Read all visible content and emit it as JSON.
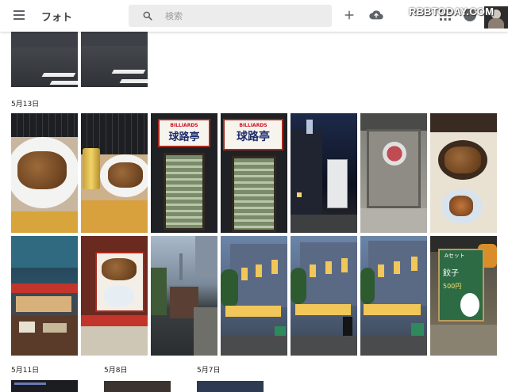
{
  "app": {
    "title": "フォト",
    "search_placeholder": "検索",
    "watermark": "RBBTODAY.COM"
  },
  "icons": {
    "menu": "menu-icon",
    "search": "search-icon",
    "add": "add-icon",
    "upload": "cloud-upload-icon",
    "apps": "apps-grid-icon",
    "account": "account-circle-icon"
  },
  "sections": [
    {
      "date": "5月13日"
    },
    {
      "date": "5月11日"
    },
    {
      "date": "5月8日"
    },
    {
      "date": "5月7日"
    }
  ],
  "photos": {
    "stairs_sign_1": "BILLIARDS",
    "stairs_sign_1_kanji": "球路亭",
    "stairs_sign_2": "BILLIARDS",
    "stairs_sign_2_kanji": "球路亭",
    "board_line1": "Aセット",
    "board_line2": "餃子",
    "board_price": "500円"
  },
  "colors": {
    "topbar_bg": "#ffffff",
    "search_bg": "#ececec",
    "icon_gray": "#5f6368"
  }
}
